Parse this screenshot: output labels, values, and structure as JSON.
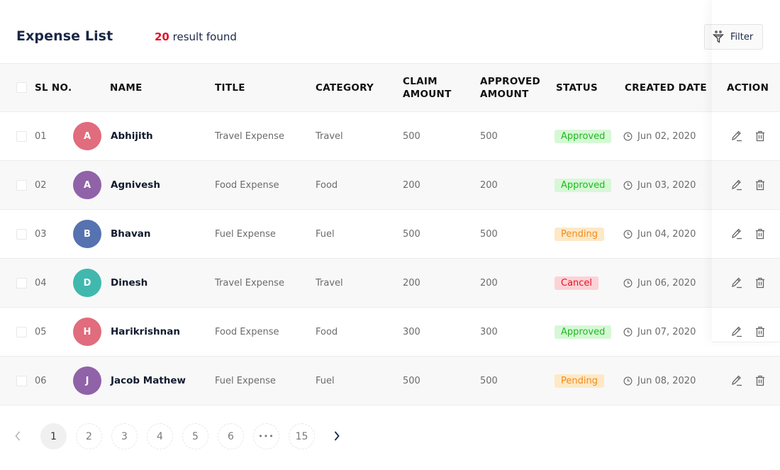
{
  "header": {
    "title": "Expense List",
    "result_count": "20",
    "result_text": "result found",
    "filter_label": "Filter"
  },
  "colors": {
    "accent_red": "#e3122b",
    "approved_bg": "#d6f8d6",
    "approved_fg": "#1eb81e",
    "pending_bg": "#fde9c7",
    "pending_fg": "#f28a1a",
    "cancel_bg": "#fcd2d5",
    "cancel_fg": "#e3122b"
  },
  "table": {
    "columns": {
      "sl": "SL NO.",
      "name": "NAME",
      "title": "TITLE",
      "category": "CATEGORY",
      "claim_1": "CLAIM",
      "claim_2": "AMOUNT",
      "approved_1": "APPROVED",
      "approved_2": "AMOUNT",
      "status": "STATUS",
      "created": "CREATED DATE",
      "action": "ACTION"
    },
    "rows": [
      {
        "sl": "01",
        "initial": "A",
        "avatar_color": "#e06c7d",
        "name": "Abhijith",
        "title": "Travel Expense",
        "category": "Travel",
        "claim": "500",
        "approved": "500",
        "status": "Approved",
        "status_type": "approved",
        "date": "Jun 02, 2020"
      },
      {
        "sl": "02",
        "initial": "A",
        "avatar_color": "#9062a8",
        "name": "Agnivesh",
        "title": "Food Expense",
        "category": "Food",
        "claim": "200",
        "approved": "200",
        "status": "Approved",
        "status_type": "approved",
        "date": "Jun 03, 2020"
      },
      {
        "sl": "03",
        "initial": "B",
        "avatar_color": "#5672b0",
        "name": "Bhavan",
        "title": "Fuel Expense",
        "category": "Fuel",
        "claim": "500",
        "approved": "500",
        "status": "Pending",
        "status_type": "pending",
        "date": "Jun 04, 2020"
      },
      {
        "sl": "04",
        "initial": "D",
        "avatar_color": "#40b8ae",
        "name": "Dinesh",
        "title": "Travel Expense",
        "category": "Travel",
        "claim": "200",
        "approved": "200",
        "status": "Cancel",
        "status_type": "cancel",
        "date": "Jun 06, 2020"
      },
      {
        "sl": "05",
        "initial": "H",
        "avatar_color": "#e06c7d",
        "name": "Harikrishnan",
        "title": "Food Expense",
        "category": "Food",
        "claim": "300",
        "approved": "300",
        "status": "Approved",
        "status_type": "approved",
        "date": "Jun 07, 2020"
      },
      {
        "sl": "06",
        "initial": "J",
        "avatar_color": "#9062a8",
        "name": "Jacob Mathew",
        "title": "Fuel Expense",
        "category": "Fuel",
        "claim": "500",
        "approved": "500",
        "status": "Pending",
        "status_type": "pending",
        "date": "Jun 08, 2020"
      }
    ]
  },
  "pagination": {
    "current": "1",
    "pages": [
      "1",
      "2",
      "3",
      "4",
      "5",
      "6",
      "•••",
      "15"
    ]
  }
}
